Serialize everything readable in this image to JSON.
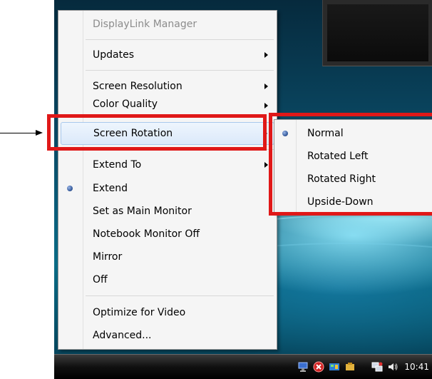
{
  "menu": {
    "title": "DisplayLink Manager",
    "items": [
      {
        "label": "Updates"
      },
      {
        "label": "Screen Resolution"
      },
      {
        "label": "Color Quality"
      },
      {
        "label": "Screen Rotation"
      },
      {
        "label": "Extend To"
      },
      {
        "label": "Extend"
      },
      {
        "label": "Set as Main Monitor"
      },
      {
        "label": "Notebook Monitor Off"
      },
      {
        "label": "Mirror"
      },
      {
        "label": "Off"
      },
      {
        "label": "Optimize for Video"
      },
      {
        "label": "Advanced..."
      }
    ],
    "selected": "Extend",
    "highlighted": "Screen Rotation"
  },
  "submenu": {
    "items": [
      {
        "label": "Normal"
      },
      {
        "label": "Rotated Left"
      },
      {
        "label": "Rotated Right"
      },
      {
        "label": "Upside-Down"
      }
    ],
    "selected": "Normal"
  },
  "taskbar": {
    "clock": "10:41",
    "tray_icons": [
      "displaylink-monitor-icon",
      "security-alert-icon",
      "network-icon",
      "speaker-icon"
    ]
  },
  "colors": {
    "annotation_red": "#e01818",
    "highlight_border": "#a8c8ec"
  }
}
